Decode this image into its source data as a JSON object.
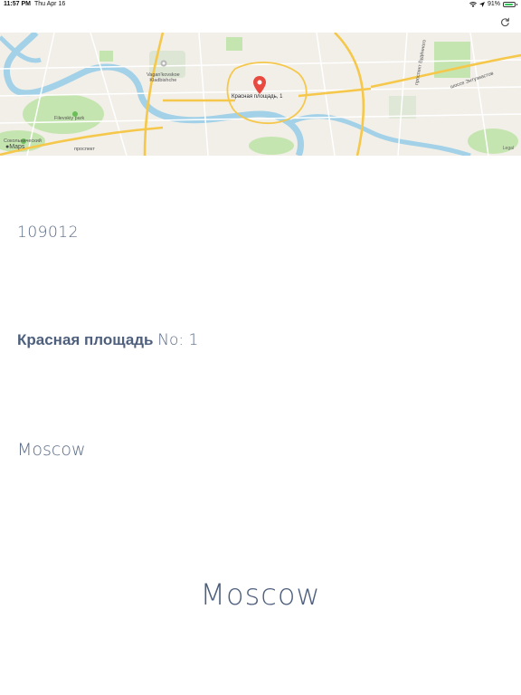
{
  "status_bar": {
    "time": "11:57 PM",
    "date": "Thu Apr 16",
    "battery": "91%"
  },
  "toolbar": {
    "refresh_icon": "refresh-icon"
  },
  "map": {
    "pin_label": "Красная площадь, 1",
    "maps_logo": "Maps",
    "legal": "Legal",
    "labels": {
      "cemetery": "Vagan'kovskoe\nKladbishche",
      "park": "Filevskiy park",
      "left_park": "Сокольнический",
      "prospekt": "проспект",
      "shosse": "шоссе Энтузиастов",
      "avenue": "проспект Будённого"
    },
    "colors": {
      "background": "#f2efe9",
      "major_road": "#f5c84c",
      "minor_road": "#ffffff",
      "water": "#a3d1e8",
      "green": "#c5e5b0",
      "pin": "#e94a3f"
    }
  },
  "address": {
    "postal_code": "109012",
    "street": "Красная площадь",
    "house": "No: 1",
    "city": "Moscow"
  },
  "title": {
    "city": "Moscow"
  },
  "colors": {
    "text": "#4d5f7c"
  }
}
